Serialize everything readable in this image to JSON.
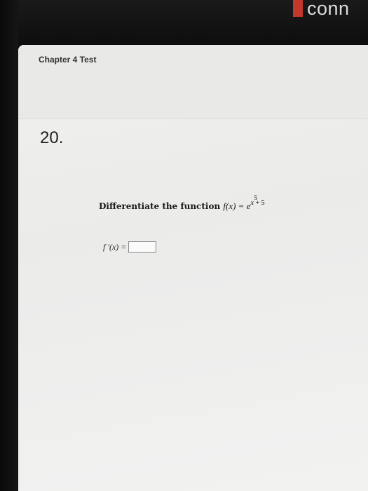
{
  "branding": {
    "logo_text": "conn",
    "logo_color": "#c0392b"
  },
  "header": {
    "title": "Chapter 4 Test"
  },
  "question": {
    "number": "20.",
    "prompt_text": "Differentiate the function",
    "function_lhs": "f(x) = ",
    "base": "e",
    "exponent_var": "x",
    "exponent_power": "5",
    "exponent_rest": " + 5",
    "answer_label": "f ′(x) = ",
    "answer_value": ""
  }
}
